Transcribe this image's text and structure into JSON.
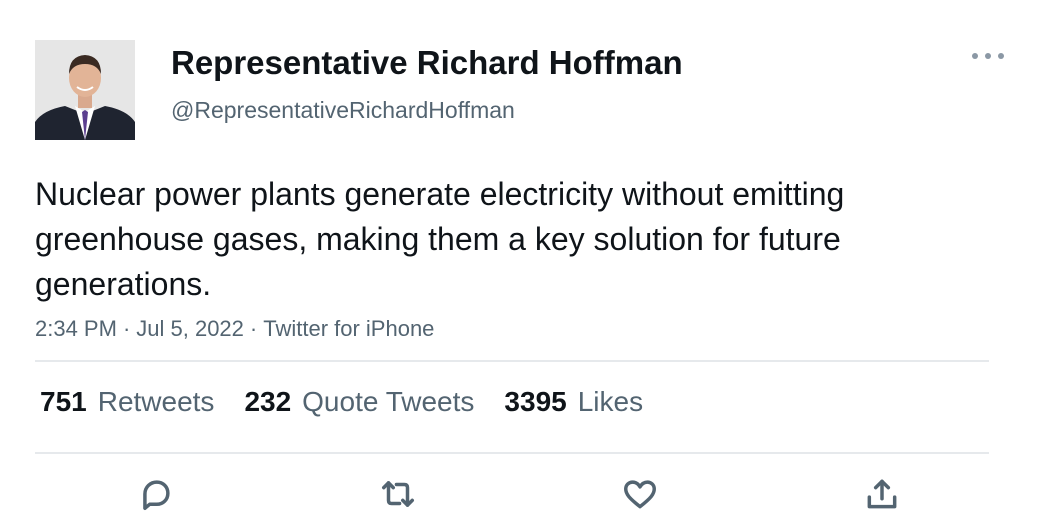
{
  "author": {
    "display_name": "Representative Richard Hoffman",
    "handle": "@RepresentativeRichardHoffman"
  },
  "tweet": {
    "text": "Nuclear power plants generate electricity without emitting greenhouse gases, making them a key solution for future generations.",
    "time": "2:34 PM",
    "date": "Jul 5, 2022",
    "source": "Twitter for iPhone",
    "separator": "·"
  },
  "stats": {
    "retweets": {
      "count": "751",
      "label": "Retweets"
    },
    "quote_tweets": {
      "count": "232",
      "label": "Quote Tweets"
    },
    "likes": {
      "count": "3395",
      "label": "Likes"
    }
  },
  "icons": {
    "more": "more-horizontal-icon",
    "reply": "reply-icon",
    "retweet": "retweet-icon",
    "like": "heart-icon",
    "share": "share-icon"
  },
  "colors": {
    "text_primary": "#0f1419",
    "text_secondary": "#536471",
    "divider": "#e6e9ec"
  }
}
